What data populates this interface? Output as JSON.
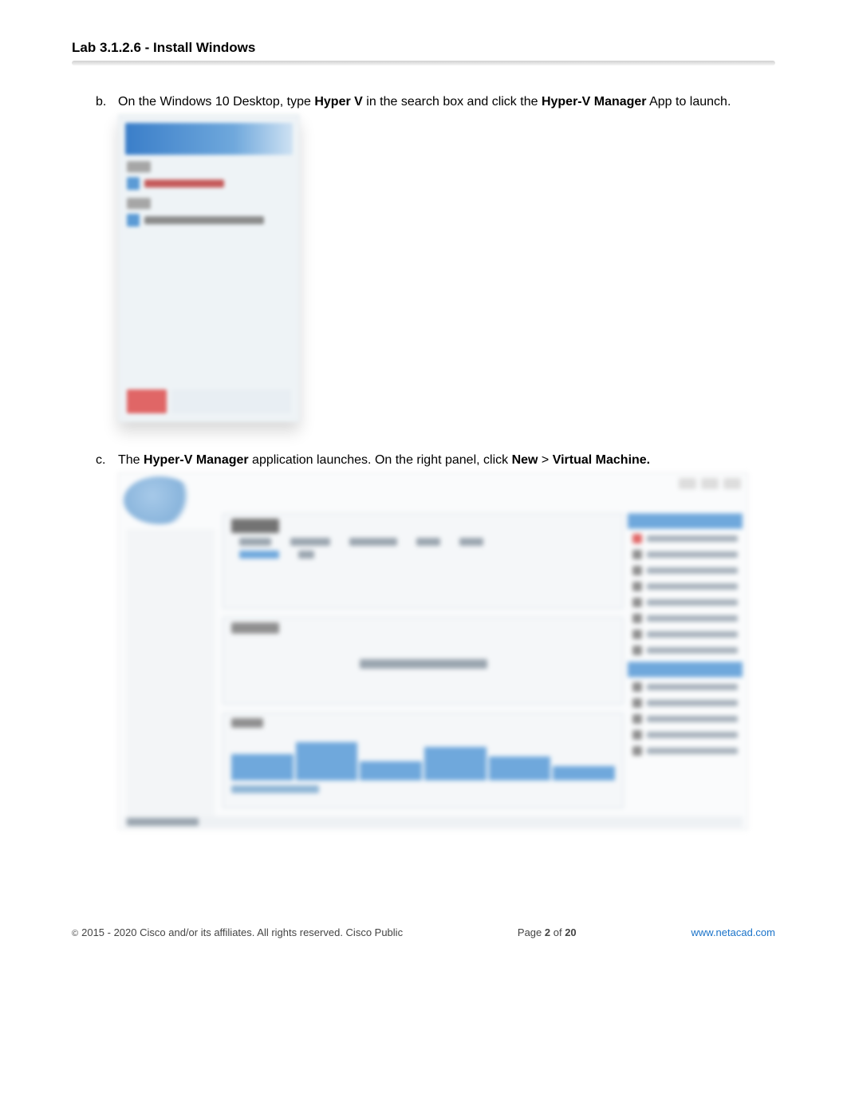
{
  "header": {
    "title": "Lab 3.1.2.6 - Install Windows"
  },
  "steps": {
    "b": {
      "letter": "b.",
      "pre": "On the Windows 10 Desktop, type ",
      "bold1": "Hyper V",
      "mid": " in the search box and click the ",
      "bold2": "Hyper-V Manager",
      "post": "  App to launch."
    },
    "c": {
      "letter": "c.",
      "pre": "The ",
      "bold1": "Hyper-V Manager",
      "mid": "  application launches. On the right panel, click ",
      "bold2": "New",
      "gt": " > ",
      "bold3": "Virtual Machine."
    }
  },
  "footer": {
    "copyright_symbol": "©",
    "copyright": "2015 - 2020 Cisco and/or its affiliates. All rights reserved. Cisco Public",
    "page_label": "Page ",
    "page_current": "2",
    "page_of": " of ",
    "page_total": "20",
    "link": "www.netacad.com"
  }
}
